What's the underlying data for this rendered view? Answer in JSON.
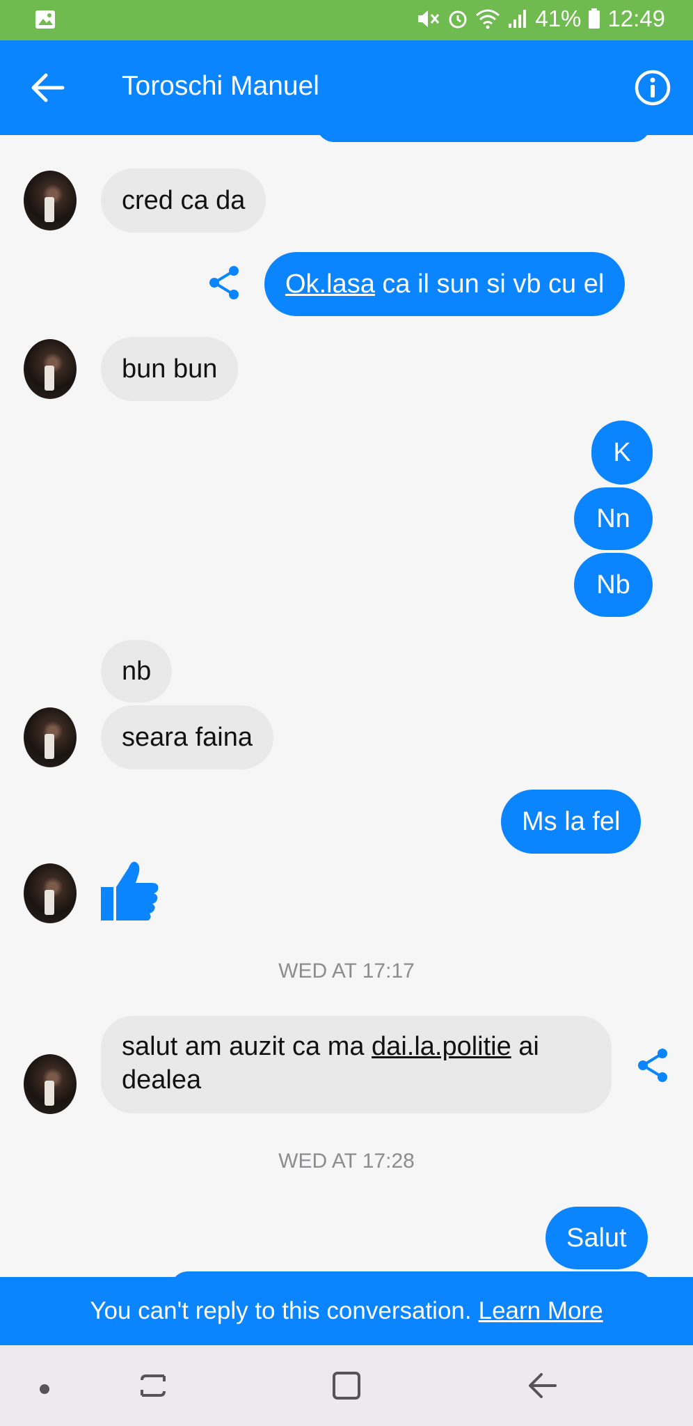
{
  "status_bar": {
    "battery": "41%",
    "time": "12:49"
  },
  "header": {
    "title": "Toroschi Manuel"
  },
  "messages": {
    "m1": "cred ca da",
    "m2_link": "Ok.lasa",
    "m2_rest": " ca il sun si vb cu el",
    "m3": "bun bun",
    "m4": "K",
    "m5": "Nn",
    "m6": "Nb",
    "m7": "nb",
    "m8": "seara faina",
    "m9": "Ms la fel",
    "m10_a": "salut am auzit ca ma ",
    "m10_link": "dai.la.politie",
    "m10_b": " ai",
    "m10_line2": "dealea",
    "m11": "Salut"
  },
  "timestamps": {
    "t1": "WED AT 17:17",
    "t2": "WED AT 17:28"
  },
  "banner": {
    "text": "You can't reply to this conversation.",
    "link": "Learn More"
  },
  "colors": {
    "accent": "#0a84ff",
    "status_bar": "#6fbb4f",
    "incoming": "#e9e9ea"
  },
  "icons": {
    "back": "arrow-left-icon",
    "info": "info-icon",
    "share": "share-icon",
    "like": "thumbs-up-icon"
  }
}
